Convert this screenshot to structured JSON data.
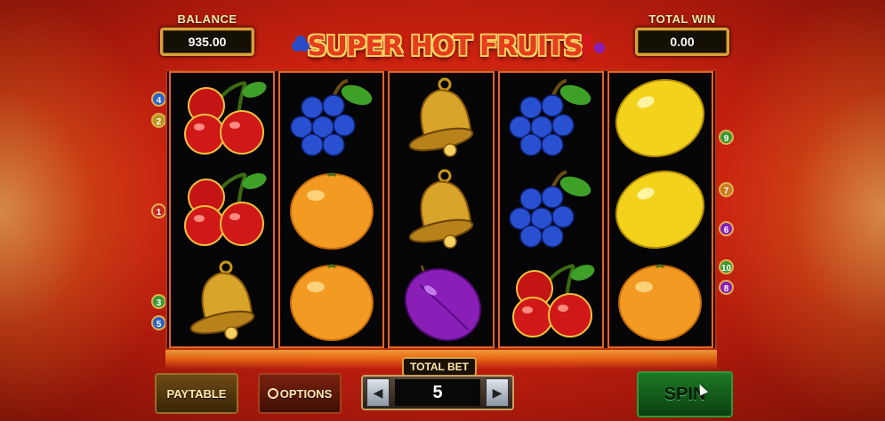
{
  "header": {
    "balance_label": "BALANCE",
    "balance_value": "935.00",
    "total_win_label": "TOTAL WIN",
    "total_win_value": "0.00",
    "logo": "SUPER HOT FRUITS"
  },
  "reels": [
    [
      "cherry",
      "cherry",
      "bell"
    ],
    [
      "grapes",
      "orange",
      "orange"
    ],
    [
      "bell",
      "bell",
      "plum"
    ],
    [
      "grapes",
      "grapes",
      "cherry"
    ],
    [
      "lemon",
      "lemon",
      "orange"
    ]
  ],
  "paylines": {
    "left": [
      "4",
      "2",
      "1",
      "3",
      "5"
    ],
    "right": [
      "9",
      "7",
      "6",
      "10",
      "8"
    ]
  },
  "controls": {
    "paytable": "PAYTABLE",
    "options": "OPTIONS",
    "total_bet_label": "TOTAL BET",
    "total_bet_value": "5",
    "spin": "SPIN",
    "prev_icon": "chevron-left-icon",
    "next_icon": "chevron-right-icon"
  },
  "colors": {
    "background": "#d42a14",
    "gold": "#d7a23a",
    "spin_green": "#1d7a25"
  }
}
